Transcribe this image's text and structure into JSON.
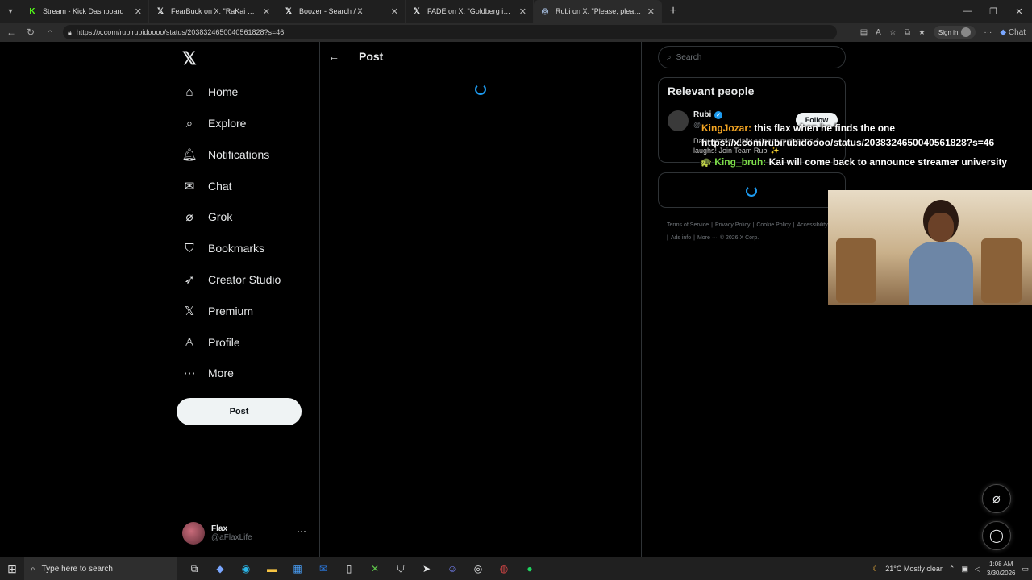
{
  "browser": {
    "tabs": [
      {
        "title": "Stream - Kick Dashboard",
        "fav": "K",
        "fav_color": "#53fc18"
      },
      {
        "title": "FearBuck on X: \"RaKai held a cour",
        "fav": "𝕏",
        "fav_color": "#e7e9ea"
      },
      {
        "title": "Boozer - Search / X",
        "fav": "𝕏",
        "fav_color": "#e7e9ea"
      },
      {
        "title": "FADE on X: \"Goldberg is still pisse",
        "fav": "𝕏",
        "fav_color": "#e7e9ea"
      },
      {
        "title": "Rubi on X: \"Please, please please",
        "fav": "◎",
        "fav_color": "#9fb6d6"
      }
    ],
    "url": "https://x.com/rubirubidoooo/status/2038324650040561828?s=46",
    "signin_label": "Sign in",
    "chat_label": "Chat"
  },
  "nav": {
    "items": [
      {
        "label": "Home",
        "icon": "home-icon"
      },
      {
        "label": "Explore",
        "icon": "search-icon"
      },
      {
        "label": "Notifications",
        "icon": "bell-icon"
      },
      {
        "label": "Chat",
        "icon": "mail-icon"
      },
      {
        "label": "Grok",
        "icon": "grok-icon"
      },
      {
        "label": "Bookmarks",
        "icon": "bookmark-icon"
      },
      {
        "label": "Creator Studio",
        "icon": "rocket-icon"
      },
      {
        "label": "Premium",
        "icon": "x-icon"
      },
      {
        "label": "Profile",
        "icon": "person-icon"
      },
      {
        "label": "More",
        "icon": "more-circle-icon"
      }
    ],
    "post_label": "Post",
    "account": {
      "name": "Flax",
      "handle": "@aFlaxLife"
    }
  },
  "main": {
    "title": "Post"
  },
  "sidebar": {
    "search_placeholder": "Search",
    "relevant_title": "Relevant people",
    "person": {
      "name": "Rubi",
      "handle": "@",
      "bio": "Daily pranks, daily science curiosities & laughs! Join Team Rubi ✨",
      "follow_label": "Follow"
    },
    "footer": [
      "Terms of Service",
      "|",
      "Privacy Policy",
      "|",
      "Cookie Policy",
      "|",
      "Accessibility",
      "|",
      "Ads info",
      "|",
      "More ···",
      "© 2026 X Corp."
    ]
  },
  "overlay_chat": [
    {
      "user": "KingJozar",
      "sep": ":",
      "message": "this flax when he finds the one",
      "user_color": "#f5a623"
    },
    {
      "user": "",
      "sep": "",
      "message": "https://x.com/rubirubidoooo/status/2038324650040561828?s=46",
      "user_color": ""
    },
    {
      "user": "King_bruh",
      "sep": ":",
      "message": "Kai will come back to announce streamer university",
      "user_color": "#7ddc4a"
    }
  ],
  "taskbar": {
    "search_placeholder": "Type here to search",
    "weather": "21°C  Mostly clear",
    "time": "1:08 AM",
    "date": "3/30/2026"
  }
}
